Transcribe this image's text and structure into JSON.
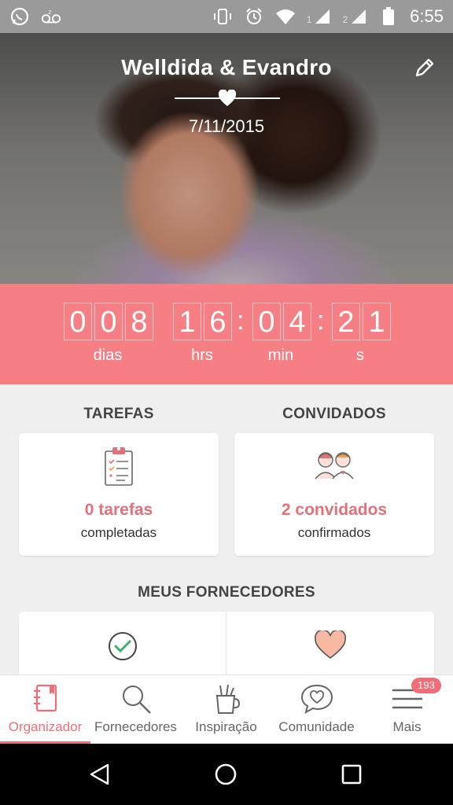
{
  "status_bar": {
    "sim1_label": "1",
    "sim2_label": "2",
    "time": "6:55"
  },
  "hero": {
    "couple_names": "Welldida & Evandro",
    "wedding_date": "7/11/2015"
  },
  "countdown": {
    "days_digits": [
      "0",
      "0",
      "8"
    ],
    "hours_digits": [
      "1",
      "6"
    ],
    "minutes_digits": [
      "0",
      "4"
    ],
    "seconds_digits": [
      "2",
      "1"
    ],
    "days_label": "dias",
    "hours_label": "hrs",
    "minutes_label": "min",
    "seconds_label": "s"
  },
  "tasks": {
    "title": "TAREFAS",
    "value": "0 tarefas",
    "sub": "completadas"
  },
  "guests": {
    "title": "CONVIDADOS",
    "value": "2 convidados",
    "sub": "confirmados"
  },
  "suppliers": {
    "title": "MEUS FORNECEDORES"
  },
  "bottom_nav": {
    "items": [
      {
        "label": "Organizador",
        "icon": "notebook-icon",
        "active": true
      },
      {
        "label": "Fornecedores",
        "icon": "search-icon",
        "active": false
      },
      {
        "label": "Inspiração",
        "icon": "pencil-cup-icon",
        "active": false
      },
      {
        "label": "Comunidade",
        "icon": "chat-heart-icon",
        "active": false
      },
      {
        "label": "Mais",
        "icon": "menu-icon",
        "active": false
      }
    ],
    "badge": "193"
  },
  "colors": {
    "accent": "#ef6e77",
    "countdown_bg": "#f67f85"
  }
}
